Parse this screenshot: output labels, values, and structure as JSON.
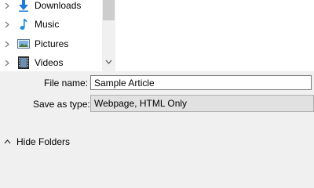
{
  "tree": {
    "items": [
      {
        "label": "Downloads",
        "icon": "download-arrow-icon"
      },
      {
        "label": "Music",
        "icon": "music-note-icon"
      },
      {
        "label": "Pictures",
        "icon": "pictures-folder-icon"
      },
      {
        "label": "Videos",
        "icon": "videos-folder-icon"
      }
    ]
  },
  "form": {
    "filename_label": "File name:",
    "filename_value": "Sample Article",
    "savetype_label": "Save as type:",
    "savetype_value": "Webpage, HTML Only"
  },
  "footer": {
    "hide_folders_label": "Hide Folders"
  },
  "colors": {
    "download_arrow": "#1e7bd6",
    "music_note": "#1e8fd6",
    "dialog_bg": "#f0f0f0"
  }
}
